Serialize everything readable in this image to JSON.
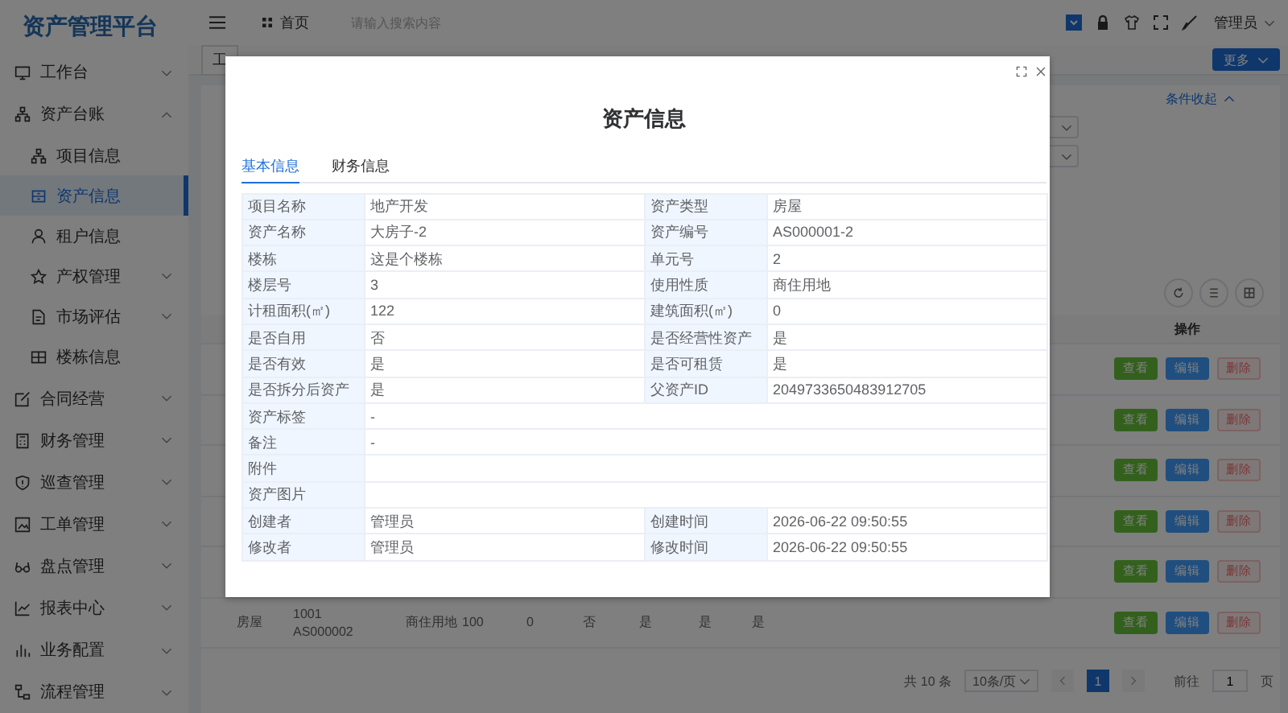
{
  "sidebar": {
    "logo": "资产管理平台",
    "items": [
      {
        "label": "工作台",
        "expanded": false,
        "selected": false
      },
      {
        "label": "资产台账",
        "expanded": true,
        "selected": false,
        "children": [
          {
            "label": "项目信息",
            "selected": false
          },
          {
            "label": "资产信息",
            "selected": true
          },
          {
            "label": "租户信息",
            "selected": false
          },
          {
            "label": "产权管理",
            "expanded": false,
            "selected": false
          },
          {
            "label": "市场评估",
            "expanded": false,
            "selected": false
          },
          {
            "label": "楼栋信息",
            "selected": false
          }
        ]
      },
      {
        "label": "合同经营",
        "expanded": false,
        "selected": false
      },
      {
        "label": "财务管理",
        "expanded": false,
        "selected": false
      },
      {
        "label": "巡查管理",
        "expanded": false,
        "selected": false
      },
      {
        "label": "工单管理",
        "expanded": false,
        "selected": false
      },
      {
        "label": "盘点管理",
        "expanded": false,
        "selected": false
      },
      {
        "label": "报表中心",
        "expanded": false,
        "selected": false
      },
      {
        "label": "业务配置",
        "expanded": false,
        "selected": false
      },
      {
        "label": "流程管理",
        "expanded": false,
        "selected": false
      }
    ]
  },
  "header": {
    "home_tab": "首页",
    "search": {
      "placeholder": "请输入搜索内容"
    },
    "user": "管理员"
  },
  "tags": [
    {
      "label": "工",
      "selected": false
    }
  ],
  "more_button": "更多",
  "filter": {
    "collapse_toggle": "条件收起"
  },
  "table": {
    "action_header": "操作",
    "rows": [
      {
        "actions": [
          "查看",
          "编辑",
          "删除"
        ]
      },
      {
        "actions": [
          "查看",
          "编辑",
          "删除"
        ]
      },
      {
        "actions": [
          "查看",
          "编辑",
          "删除"
        ]
      },
      {
        "actions": [
          "查看",
          "编辑",
          "删除"
        ]
      },
      {
        "actions": [
          "查看",
          "编辑",
          "删除"
        ]
      },
      {
        "cells": [
          [
            "房屋"
          ],
          [
            "1001",
            "AS000002"
          ],
          [
            "商住用地"
          ],
          [
            "100"
          ],
          [
            "0"
          ],
          [
            "否"
          ],
          [
            "是"
          ],
          [
            "是"
          ],
          [
            "是"
          ]
        ],
        "actions": [
          "查看",
          "编辑",
          "删除"
        ]
      }
    ]
  },
  "pagination": {
    "total": "共 10 条",
    "page_size": "10条/页",
    "pages": [
      {
        "label": "1",
        "selected": true
      }
    ],
    "jump_label": "前往",
    "jump_value": "1",
    "page_unit": "页"
  },
  "modal": {
    "title": "资产信息",
    "tabs": [
      {
        "label": "基本信息",
        "selected": true
      },
      {
        "label": "财务信息",
        "selected": false
      }
    ],
    "rows": [
      [
        {
          "label": "项目名称",
          "value": "地产开发"
        },
        {
          "label": "资产类型",
          "value": "房屋"
        }
      ],
      [
        {
          "label": "资产名称",
          "value": "大房子-2"
        },
        {
          "label": "资产编号",
          "value": "AS000001-2"
        }
      ],
      [
        {
          "label": "楼栋",
          "value": "这是个楼栋"
        },
        {
          "label": "单元号",
          "value": "2"
        }
      ],
      [
        {
          "label": "楼层号",
          "value": "3"
        },
        {
          "label": "使用性质",
          "value": "商住用地"
        }
      ],
      [
        {
          "label": "计租面积(㎡)",
          "value": "122"
        },
        {
          "label": "建筑面积(㎡)",
          "value": "0"
        }
      ],
      [
        {
          "label": "是否自用",
          "value": "否"
        },
        {
          "label": "是否经营性资产",
          "value": "是"
        }
      ],
      [
        {
          "label": "是否有效",
          "value": "是"
        },
        {
          "label": "是否可租赁",
          "value": "是"
        }
      ],
      [
        {
          "label": "是否拆分后资产",
          "value": "是"
        },
        {
          "label": "父资产ID",
          "value": "2049733650483912705"
        }
      ],
      [
        {
          "label": "资产标签",
          "value": "-"
        }
      ],
      [
        {
          "label": "备注",
          "value": "-"
        }
      ],
      [
        {
          "label": "附件"
        }
      ],
      [
        {
          "label": "资产图片"
        }
      ],
      [
        {
          "label": "创建者",
          "value": "管理员"
        },
        {
          "label": "创建时间",
          "value": "2026-06-22 09:50:55"
        }
      ],
      [
        {
          "label": "修改者",
          "value": "管理员"
        },
        {
          "label": "修改时间",
          "value": "2026-06-22 09:50:55"
        }
      ]
    ]
  }
}
